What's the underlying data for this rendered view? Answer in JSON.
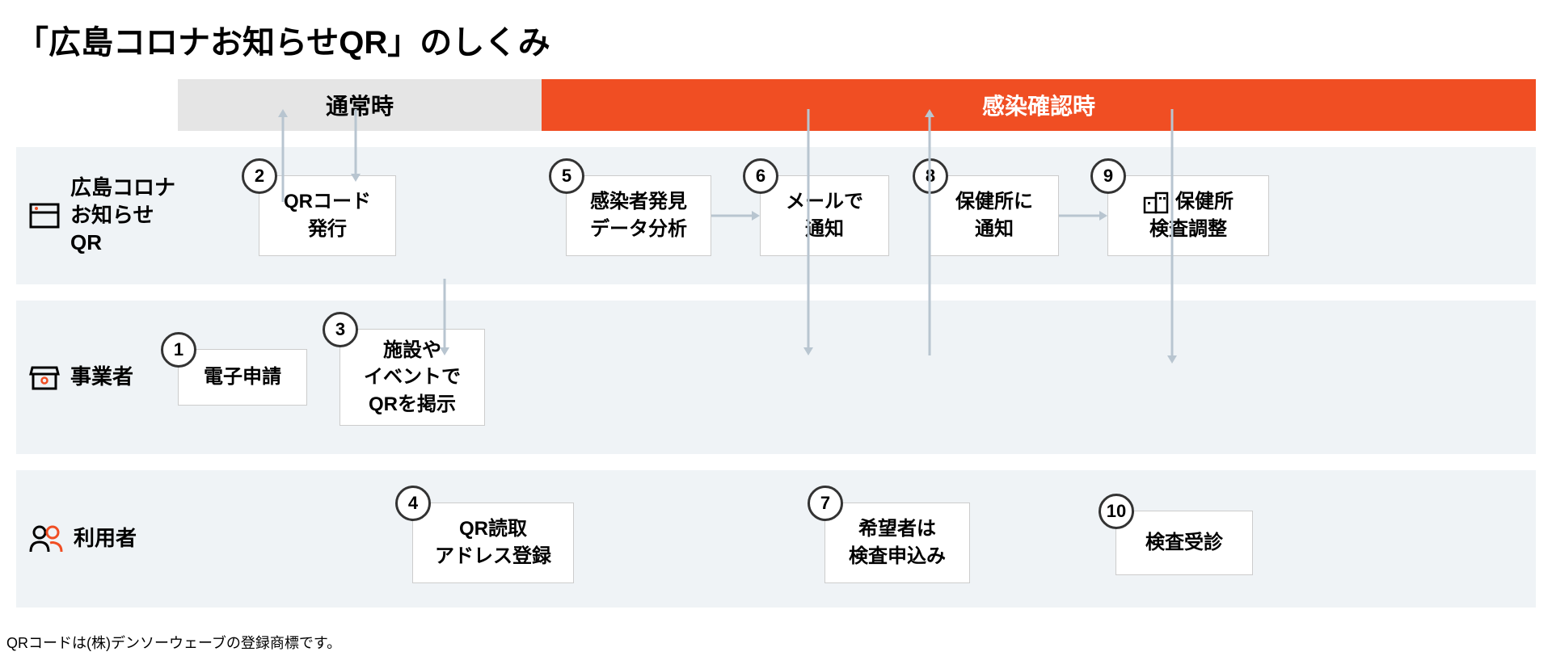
{
  "title": "「広島コロナお知らせQR」のしくみ",
  "headers": {
    "normal": "通常時",
    "infection": "感染確認時"
  },
  "lanes": {
    "system": {
      "label_line1": "広島コロナ",
      "label_line2": "お知らせQR"
    },
    "business": {
      "label": "事業者"
    },
    "user": {
      "label": "利用者"
    }
  },
  "steps": {
    "s1": {
      "num": "1",
      "line1": "電子申請"
    },
    "s2": {
      "num": "2",
      "line1": "QRコード",
      "line2": "発行"
    },
    "s3": {
      "num": "3",
      "line1": "施設や",
      "line2": "イベントで",
      "line3": "QRを掲示"
    },
    "s4": {
      "num": "4",
      "line1": "QR読取",
      "line2": "アドレス登録"
    },
    "s5": {
      "num": "5",
      "line1": "感染者発見",
      "line2": "データ分析"
    },
    "s6": {
      "num": "6",
      "line1": "メールで",
      "line2": "通知"
    },
    "s7": {
      "num": "7",
      "line1": "希望者は",
      "line2": "検査申込み"
    },
    "s8": {
      "num": "8",
      "line1": "保健所に",
      "line2": "通知"
    },
    "s9": {
      "num": "9",
      "icon_label": "保健所",
      "line1": "検査調整"
    },
    "s10": {
      "num": "10",
      "line1": "検査受診"
    }
  },
  "footnote": "QRコードは(株)デンソーウェーブの登録商標です。"
}
